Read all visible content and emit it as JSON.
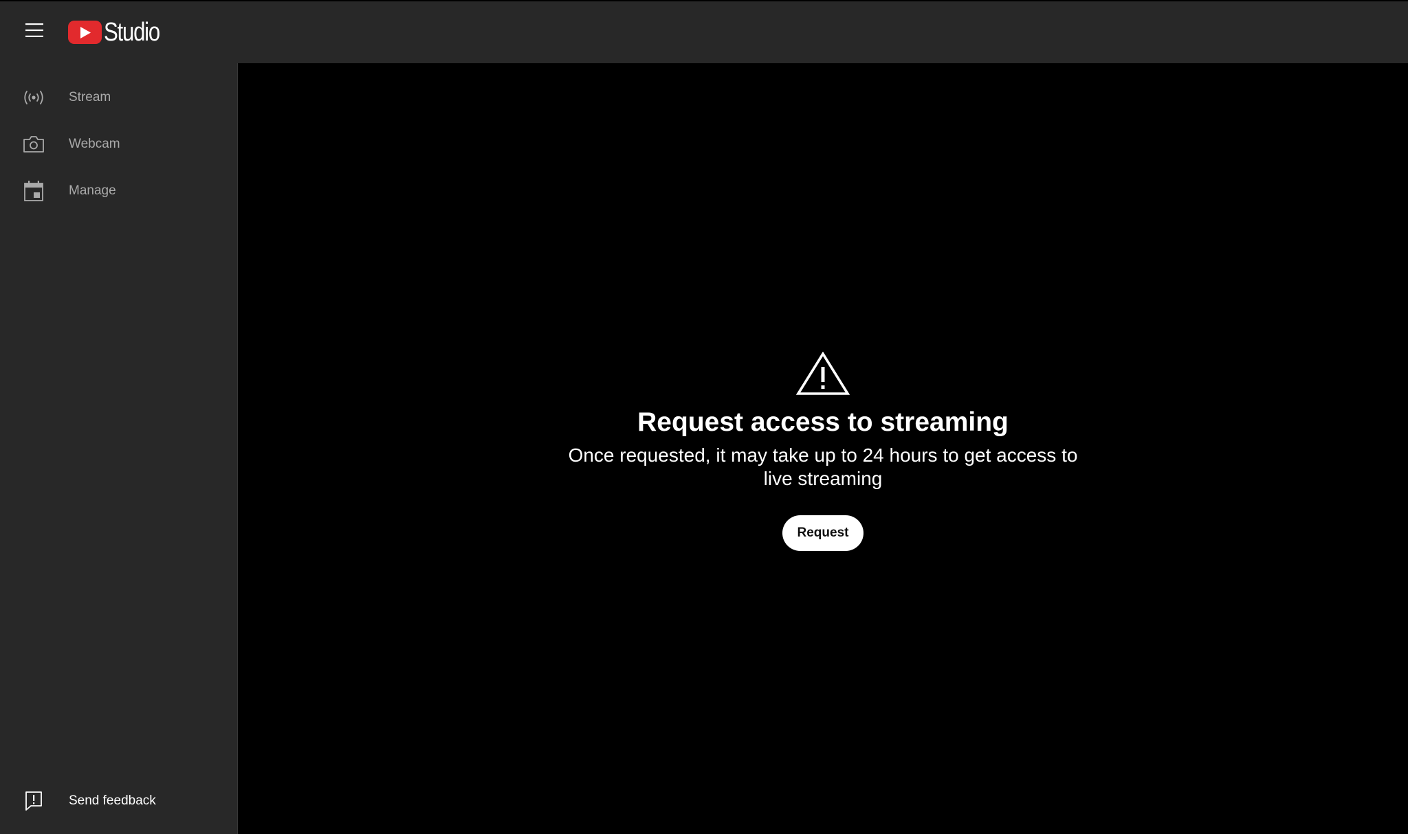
{
  "header": {
    "logo_text": "Studio",
    "brand_color": "#e22a2d",
    "menu_icon": "hamburger-menu-icon"
  },
  "sidebar": {
    "items": [
      {
        "label": "Stream",
        "icon": "broadcast-icon"
      },
      {
        "label": "Webcam",
        "icon": "camera-icon"
      },
      {
        "label": "Manage",
        "icon": "calendar-icon"
      }
    ],
    "feedback": {
      "label": "Send feedback",
      "icon": "feedback-icon"
    }
  },
  "main": {
    "icon": "warning-icon",
    "title": "Request access to streaming",
    "subtitle": "Once requested, it may take up to 24 hours to get access to live streaming",
    "button_label": "Request"
  }
}
